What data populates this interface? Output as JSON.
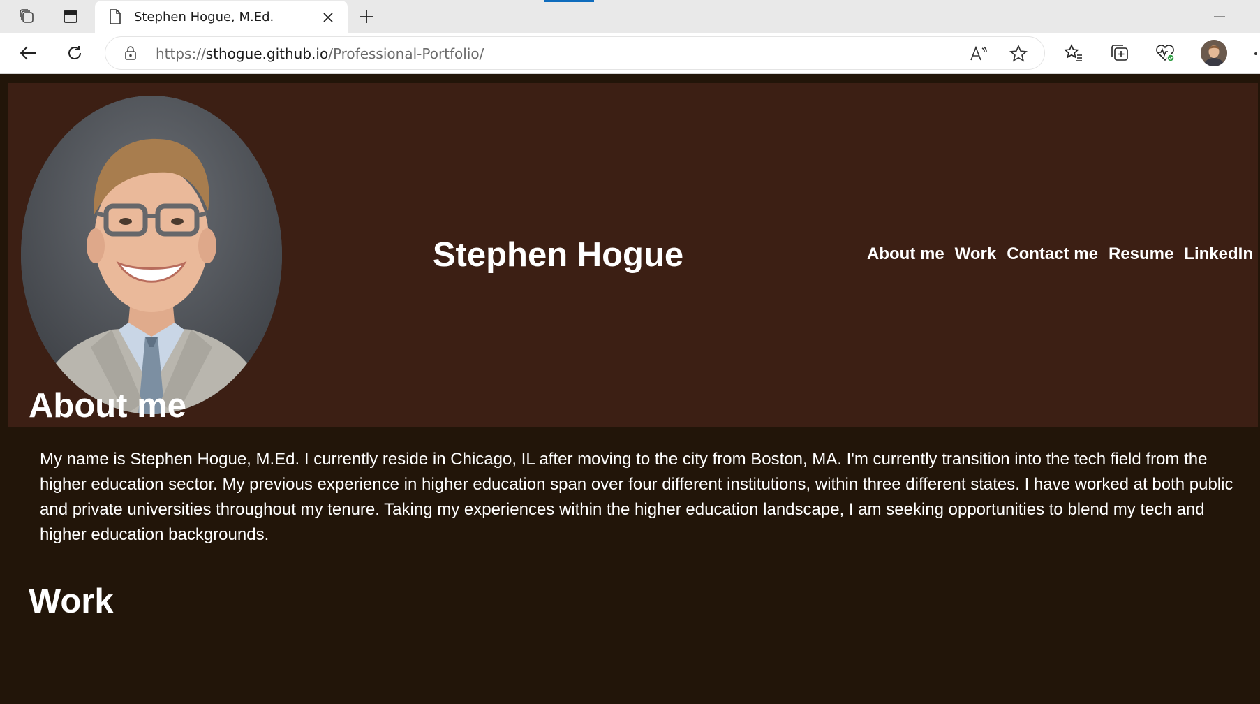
{
  "browser": {
    "tab_title": "Stephen Hogue, M.Ed.",
    "url": {
      "protocol": "https://",
      "host": "sthogue.github.io",
      "path": "/Professional-Portfolio/"
    }
  },
  "site": {
    "title": "Stephen Hogue",
    "nav": [
      "About me",
      "Work",
      "Contact me",
      "Resume",
      "LinkedIn"
    ],
    "about": {
      "heading": "About me",
      "text": "My name is Stephen Hogue, M.Ed. I currently reside in Chicago, IL after moving to the city from Boston, MA. I'm currently transition into the tech field from the higher education sector. My previous experience in higher education span over four different institutions, within three different states. I have worked at both public and private universities throughout my tenure. Taking my experiences within the higher education landscape, I am seeking opportunities to blend my tech and higher education backgrounds."
    },
    "work": {
      "heading": "Work"
    }
  },
  "colors": {
    "page_background": "#221509",
    "hero_background": "#3c1f14",
    "text": "#ffffff",
    "browser_accent": "#0f6cbd"
  },
  "icons": [
    "tab-actions-icon",
    "vertical-tabs-icon",
    "page-favicon-icon",
    "close-icon",
    "plus-icon",
    "minimize-icon",
    "back-arrow-icon",
    "refresh-icon",
    "lock-icon",
    "read-aloud-icon",
    "star-icon",
    "favorites-icon",
    "collections-icon",
    "browser-essentials-icon",
    "profile-avatar"
  ]
}
